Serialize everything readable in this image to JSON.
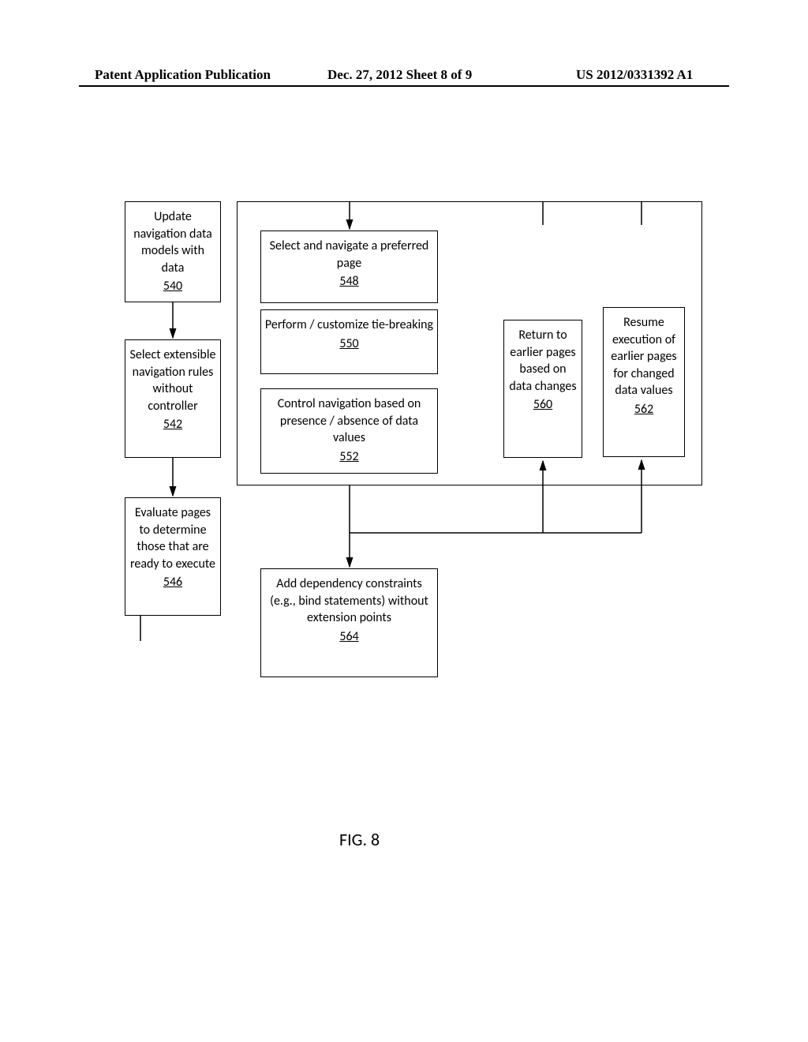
{
  "header": {
    "left": "Patent Application Publication",
    "mid": "Dec. 27, 2012  Sheet 8 of 9",
    "right": "US 2012/0331392 A1"
  },
  "boxes": {
    "b540": {
      "text": "Update navigation data models with data",
      "num": "540"
    },
    "b542": {
      "text": "Select extensible navigation rules without controller",
      "num": "542"
    },
    "b546": {
      "text": "Evaluate pages to determine those that are ready to execute",
      "num": "546"
    },
    "b548": {
      "text": "Select and navigate a preferred page",
      "num": "548"
    },
    "b550": {
      "text": "Perform / customize tie-breaking",
      "num": "550"
    },
    "b552": {
      "text": "Control navigation based on presence / absence of data values",
      "num": "552"
    },
    "b560": {
      "text": "Return to earlier pages based on data changes",
      "num": "560"
    },
    "b562": {
      "text": "Resume execution of earlier pages for changed data values",
      "num": "562"
    },
    "b564": {
      "text": "Add dependency constraints (e.g., bind statements) without extension points",
      "num": "564"
    }
  },
  "figure": "FIG. 8"
}
